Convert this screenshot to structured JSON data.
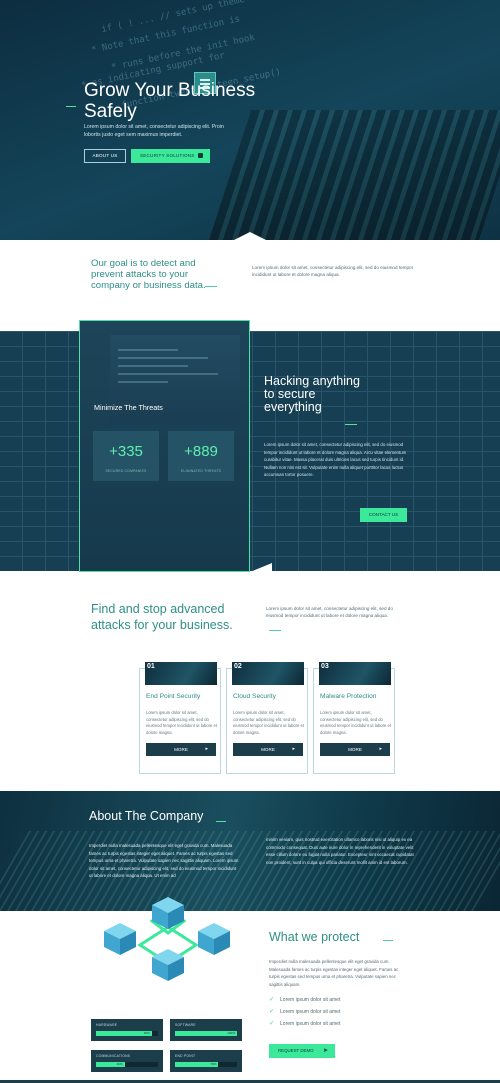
{
  "hero": {
    "title": "Grow Your Business Safely",
    "text": "Lorem ipsum dolor sit amet, consectetur adipiscing elit. Proin lobortis justo eget sem maximus imperdiet.",
    "about_button": "ABOUT US",
    "security_button": "SECURITY SOLUTIONS"
  },
  "goal": {
    "heading": "Our goal is to detect and prevent attacks to your company or business data.",
    "text": "Lorem ipsum dolor sit amet, consectetur adipiscing elit, sed do eiusmod tempor incididunt ut labore et dolore magna aliqua."
  },
  "threats": {
    "title": "Minimize The Threats",
    "stats": [
      {
        "value": "+335",
        "label": "SECURED COMPANIES"
      },
      {
        "value": "+889",
        "label": "ELIMINATED THREATS"
      }
    ],
    "heading": "Hacking anything to secure everything",
    "text": "Lorem ipsum dolor sit amet, consectetur adipiscing elit, sed do eiusmod tempor incididunt ut labore et dolore magna aliqua. Arcu vitae elementum curabitur vitae. Massa placerat duis ultricies lacus sed turpis tincidunt id. Nullam non nisi est sit. Vulputate enim nulla aliquet porttitor lacus luctus accumsan tortor posuere.",
    "contact_button": "CONTACT US"
  },
  "find": {
    "heading": "Find and stop advanced attacks for your business.",
    "text": "Lorem ipsum dolor sit amet, consectetur adipiscing elit, sed do eiusmod tempor incididunt ut labore et dolore magna aliqua."
  },
  "cards": [
    {
      "num": "01",
      "title": "End Point Security",
      "text": "Lorem ipsum dolor sit amet, consectetur adipiscing elit, sed do eiusmod tempor incididunt ut labore et dolore magna.",
      "button": "MORE"
    },
    {
      "num": "02",
      "title": "Cloud Security",
      "text": "Lorem ipsum dolor sit amet, consectetur adipiscing elit, sed do eiusmod tempor incididunt ut labore et dolore magna.",
      "button": "MORE"
    },
    {
      "num": "03",
      "title": "Malware Protection",
      "text": "Lorem ipsum dolor sit amet, consectetur adipiscing elit, sed do eiusmod tempor incididunt ut labore et dolore magna.",
      "button": "MORE"
    }
  ],
  "about": {
    "title": "About The Company",
    "left_text": "Imperdiet nulla malesuada pellentesque elit eget gravida cum. Malesuada fames ac turpis egestas integer eget aliquet. Fames ac turpis egestas sed tempus urna et pharetra. Vulputate sapien nec sagittis aliquam. Lorem ipsum dolor sit amet, consectetur adipiscing elit, sed do eiusmod tempor incididunt ut labore et dolore magna aliqua. Ut enim ad",
    "right_text": "minim veniam, quis nostrud exercitation ullamco laboris nisi ut aliquip ex ea commodo consequat. Duis aute irure dolor in reprehenderit in voluptate velit esse cillum dolore eu fugiat nulla pariatur. Excepteur sint occaecat cupidatat non proident, sunt in culpa qui officia deserunt mollit anim id est laborum."
  },
  "protect": {
    "heading": "What we protect",
    "text": "Imperdiet nulla malesuada pellentesque elit eget gravida cum. Malesuada fames ac turpis egestas integer eget aliquet. Fames ac turpis egestas sed tempus urna et pharetra. Vulputate sapien nec sagittis aliquam.",
    "checks": [
      "Lorem ipsum dolor sit amet",
      "Lorem ipsum dolor sit amet",
      "Lorem ipsum dolor sit amet"
    ],
    "demo_button": "REQUEST DEMO"
  },
  "skills": [
    {
      "label": "HARDWARE",
      "percent": 90,
      "pct_label": "90%"
    },
    {
      "label": "SOFTWARE",
      "percent": 100,
      "pct_label": "100%"
    },
    {
      "label": "COMMUNICATIONS",
      "percent": 46,
      "pct_label": "46%"
    },
    {
      "label": "END POINT",
      "percent": 70,
      "pct_label": "70%"
    }
  ],
  "colors": {
    "accent": "#3ce89a",
    "dark": "#1c3d4a",
    "teal_heading": "#2e8f86"
  }
}
